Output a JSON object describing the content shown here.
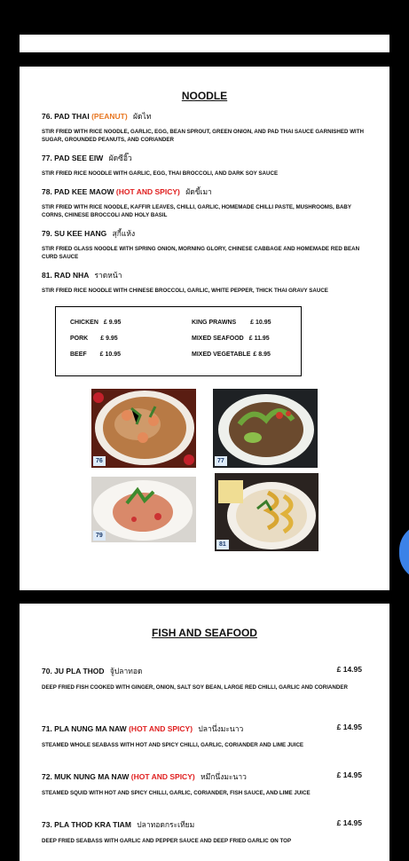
{
  "noodle": {
    "title": "NOODLE",
    "items": [
      {
        "name": "76. PAD THAI",
        "tag": "(PEANUT)",
        "thai": "ผัดไท",
        "desc": "STIR FRIED WITH RICE NOODLE, GARLIC, EGG, BEAN SPROUT, GREEN ONION, AND PAD THAI SAUCE GARNISHED WITH SUGAR, GROUNDED PEANUTS, AND CORIANDER"
      },
      {
        "name": "77. PAD SEE EIW",
        "tag": "",
        "thai": "ผัดซีอิ๊ว",
        "desc": "STIR FRIED RICE NOODLE WITH GARLIC, EGG, THAI BROCCOLI, AND DARK SOY SAUCE"
      },
      {
        "name": "78. PAD KEE MAOW",
        "tag": "(HOT AND SPICY)",
        "thai": "ผัดขี้เมา",
        "desc": "STIR FRIED WITH RICE NOODLE, KAFFIR LEAVES, CHILLI, GARLIC, HOMEMADE CHILLI PASTE, MUSHROOMS, BABY CORNS, CHINESE BROCCOLI AND HOLY BASIL"
      },
      {
        "name": "79. SU KEE HANG",
        "tag": "",
        "thai": "สุกี้แห้ง",
        "desc": "STIR FRIED GLASS NOODLE WITH SPRING ONION, MORNING GLORY, CHINESE CABBAGE AND HOMEMADE RED BEAN CURD SAUCE"
      },
      {
        "name": "81. RAD NHA",
        "tag": "",
        "thai": "ราดหน้า",
        "desc": "STIR FRIED RICE NOODLE WITH CHINESE BROCCOLI, GARLIC, WHITE PEPPER, THICK THAI GRAVY SAUCE"
      }
    ],
    "prices": {
      "chicken": {
        "label": "CHICKEN",
        "price": "£ 9.95"
      },
      "pork": {
        "label": "PORK",
        "price": "£ 9.95"
      },
      "beef": {
        "label": "BEEF",
        "price": "£ 10.95"
      },
      "king_prawns": {
        "label": "KING PRAWNS",
        "price": "£ 10.95"
      },
      "mixed_seafood": {
        "label": "MIXED SEAFOOD",
        "price": "£ 11.95"
      },
      "mixed_vegetable": {
        "label": "MIXED VEGETABLE",
        "price": "£ 8.95"
      }
    },
    "photos": [
      "76",
      "77",
      "79",
      "81"
    ]
  },
  "fish": {
    "title": "FISH AND SEAFOOD",
    "items": [
      {
        "name": "70. JU PLA THOD",
        "tag": "",
        "thai": "จู้ปลาทอด",
        "price": "£ 14.95",
        "desc": "DEEP FRIED FISH COOKED WITH GINGER, ONION, SALT SOY BEAN, LARGE RED CHILLI, GARLIC AND CORIANDER"
      },
      {
        "name": "71. PLA NUNG MA NAW",
        "tag": "(HOT AND SPICY)",
        "thai": "ปลานึ่งมะนาว",
        "price": "£ 14.95",
        "desc": "STEAMED WHOLE SEABASS WITH HOT AND SPICY CHILLI, GARLIC, CORIANDER AND LIME JUICE"
      },
      {
        "name": "72. MUK NUNG MA NAW",
        "tag": "(HOT AND SPICY)",
        "thai": "หมึกนึ่งมะนาว",
        "price": "£ 14.95",
        "desc": "STEAMED SQUID WITH HOT AND SPICY CHILLI, GARLIC, CORIANDER, FISH SAUCE, AND LIME JUICE"
      },
      {
        "name": "73. PLA THOD KRA TIAM",
        "tag": "",
        "thai": "ปลาทอดกระเทียม",
        "price": "£ 14.95",
        "desc": "DEEP FRIED SEABASS WITH GARLIC AND PEPPER SAUCE AND DEEP FRIED GARLIC ON TOP"
      }
    ]
  },
  "colors": {
    "tag_orange": "#e87722",
    "tag_red": "#e02020",
    "side_tab": "#3b82e8"
  }
}
